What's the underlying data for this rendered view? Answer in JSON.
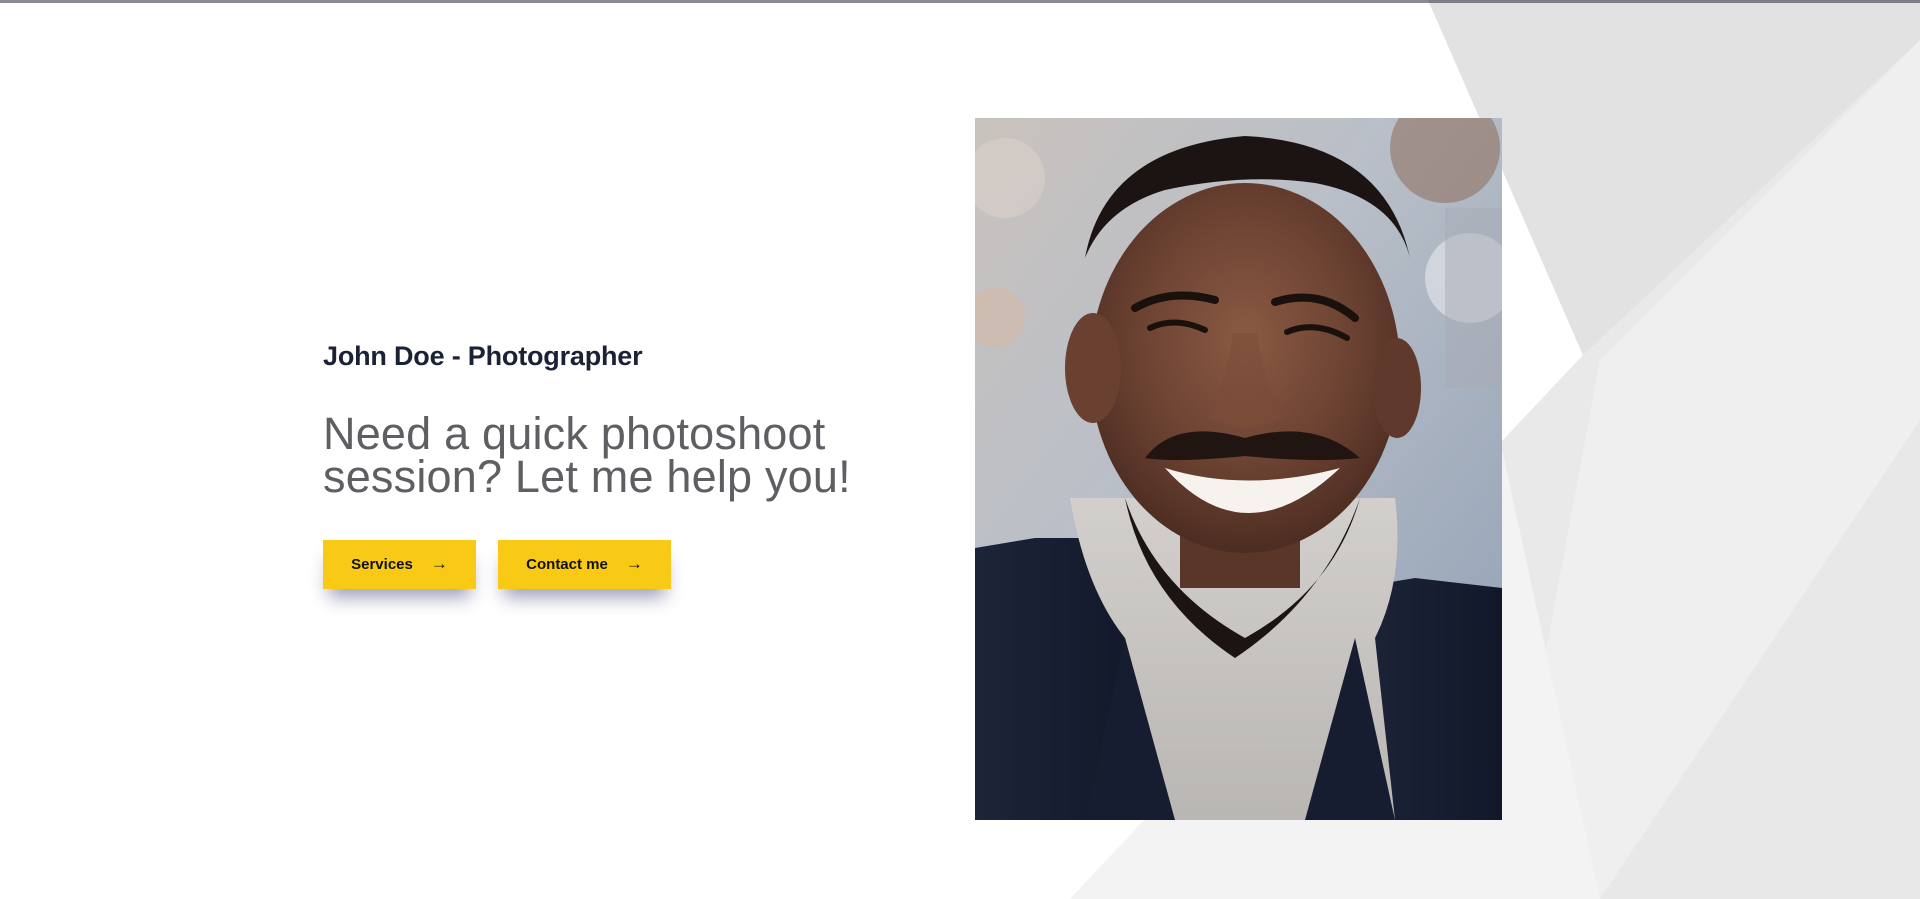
{
  "hero": {
    "title": "John Doe - Photographer",
    "tagline": "Need a quick photoshoot session? Let me help you!",
    "buttons": [
      {
        "label": "Services",
        "icon": "arrow-right-icon"
      },
      {
        "label": "Contact me",
        "icon": "arrow-right-icon"
      }
    ]
  },
  "portrait": {
    "subject": "smiling man in a dark blazer and light gray turtleneck"
  },
  "colors": {
    "accent": "#f8c915",
    "title": "#1b2136",
    "tagline": "#5f5f63",
    "background_shapes": "#ececec"
  }
}
